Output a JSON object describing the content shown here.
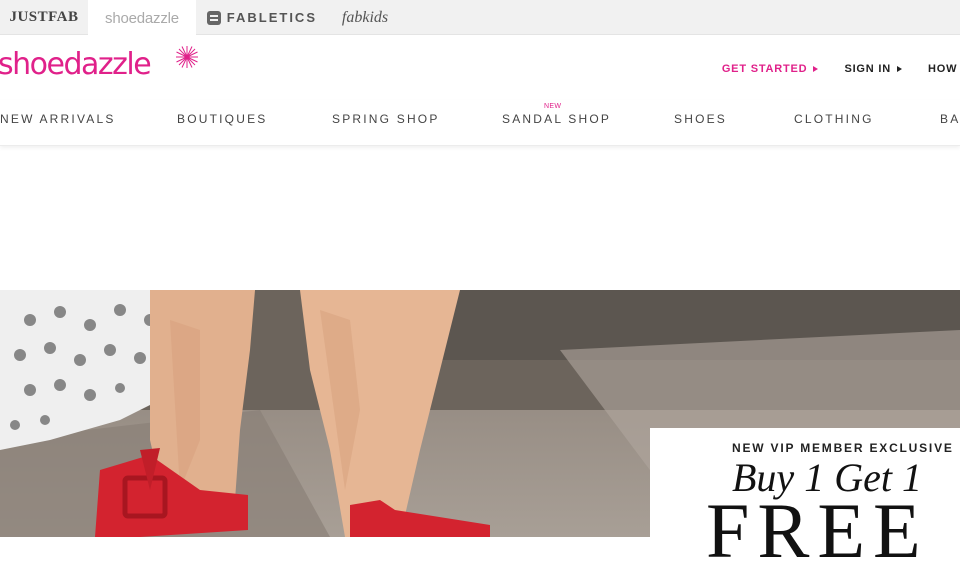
{
  "brand_bar": {
    "justfab": "JUSTFAB",
    "shoedazzle": "shoedazzle",
    "fabletics": "FABLETICS",
    "fabkids": "fabkids"
  },
  "header": {
    "logo": "shoedazzle",
    "nav": {
      "get_started": "GET STARTED",
      "sign_in": "SIGN IN",
      "how": "HOW I"
    }
  },
  "main_nav": {
    "new_badge": "NEW",
    "items": [
      "NEW ARRIVALS",
      "BOUTIQUES",
      "SPRING SHOP",
      "SANDAL SHOP",
      "SHOES",
      "CLOTHING",
      "BAG"
    ]
  },
  "promo": {
    "eyebrow": "NEW VIP MEMBER EXCLUSIVE",
    "headline": "Buy 1 Get 1",
    "free": "FREE"
  },
  "colors": {
    "accent": "#e0218a",
    "shoe": "#d3232f"
  }
}
